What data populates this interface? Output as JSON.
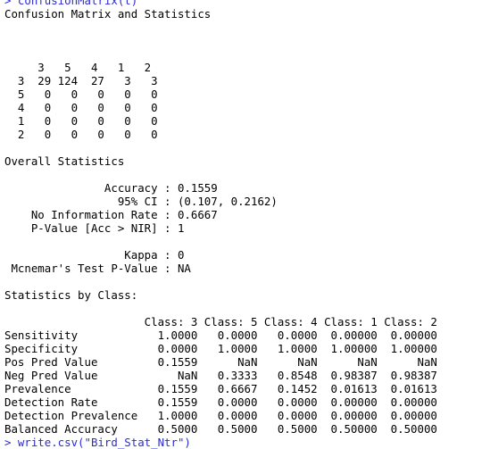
{
  "console": {
    "top_partial_line": "> confusionMatrix(t)",
    "title": "Confusion Matrix and Statistics",
    "matrix": {
      "header": "     3   5   4   1   2",
      "rows": [
        "  3  29 124  27   3   3",
        "  5   0   0   0   0   0",
        "  4   0   0   0   0   0",
        "  1   0   0   0   0   0",
        "  2   0   0   0   0   0"
      ]
    },
    "overall": {
      "heading": "Overall Statistics",
      "lines": [
        "               Accuracy : 0.1559",
        "                 95% CI : (0.107, 0.2162)",
        "    No Information Rate : 0.6667",
        "    P-Value [Acc > NIR] : 1",
        "",
        "                  Kappa : 0",
        " Mcnemar's Test P-Value : NA"
      ]
    },
    "by_class": {
      "heading": "Statistics by Class:",
      "header": "                     Class: 3 Class: 5 Class: 4 Class: 1 Class: 2",
      "rows": [
        "Sensitivity            1.0000   0.0000   0.0000  0.00000  0.00000",
        "Specificity            0.0000   1.0000   1.0000  1.00000  1.00000",
        "Pos Pred Value         0.1559      NaN      NaN      NaN      NaN",
        "Neg Pred Value            NaN   0.3333   0.8548  0.98387  0.98387",
        "Prevalence             0.1559   0.6667   0.1452  0.01613  0.01613",
        "Detection Rate         0.1559   0.0000   0.0000  0.00000  0.00000",
        "Detection Prevalence   1.0000   0.0000   0.0000  0.00000  0.00000",
        "Balanced Accuracy      0.5000   0.5000   0.5000  0.50000  0.50000"
      ]
    },
    "bottom_partial_line": "> write.csv(\"Bird_Stat_Ntr\")"
  }
}
